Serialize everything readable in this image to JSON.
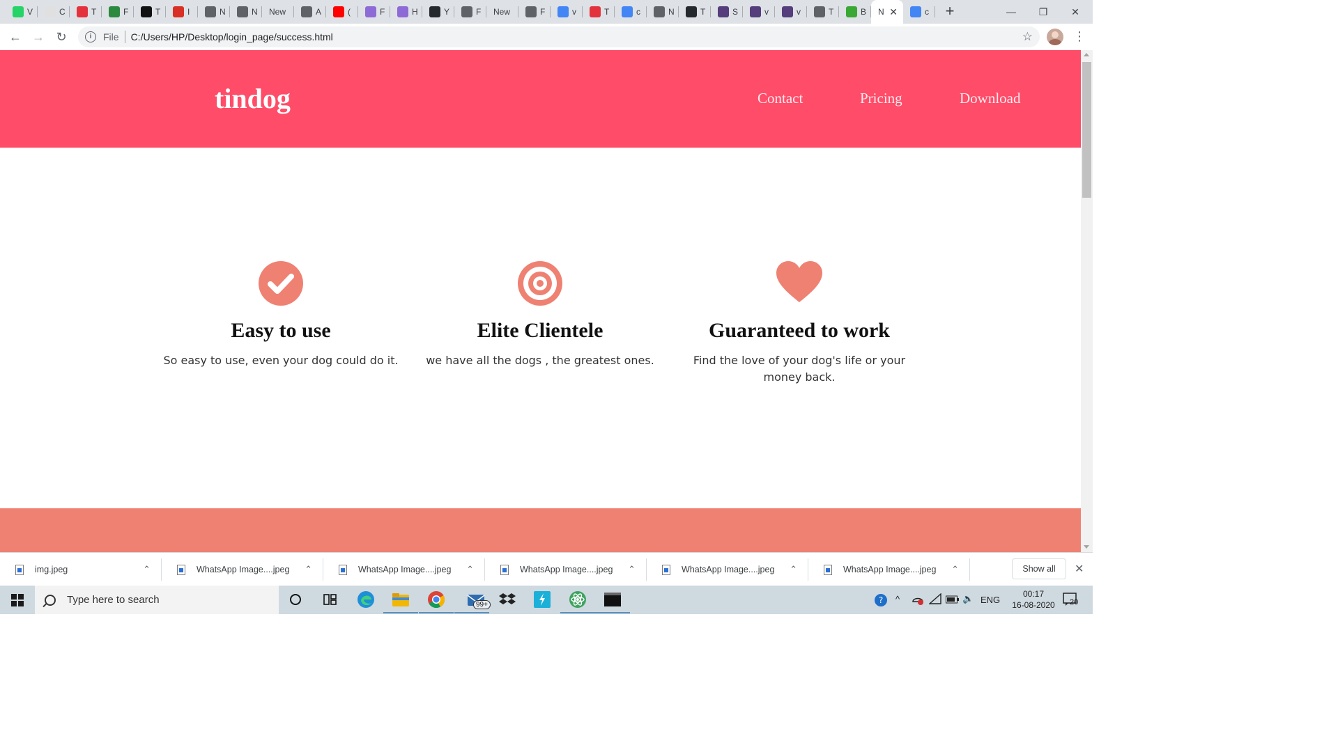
{
  "browser": {
    "tabs": [
      {
        "title": "V",
        "color": "#25d366"
      },
      {
        "title": "C",
        "color": "#e0e0e0"
      },
      {
        "title": "T",
        "color": "#e4323c"
      },
      {
        "title": "F",
        "color": "#2b8a3e"
      },
      {
        "title": "T",
        "color": "#111111"
      },
      {
        "title": "I",
        "color": "#d93025"
      },
      {
        "title": "N",
        "color": "#5f6368"
      },
      {
        "title": "N",
        "color": "#5f6368"
      },
      {
        "title": "New",
        "color": null
      },
      {
        "title": "A",
        "color": "#5f6368"
      },
      {
        "title": "(",
        "color": "#ff0000"
      },
      {
        "title": "F",
        "color": "#8e6ad6"
      },
      {
        "title": "H",
        "color": "#8e6ad6"
      },
      {
        "title": "Y",
        "color": "#24292e"
      },
      {
        "title": "F",
        "color": "#5f6368"
      },
      {
        "title": "New",
        "color": null
      },
      {
        "title": "F",
        "color": "#5f6368"
      },
      {
        "title": "v",
        "color": "#4285f4"
      },
      {
        "title": "T",
        "color": "#e4323c"
      },
      {
        "title": "c",
        "color": "#4285f4"
      },
      {
        "title": "N",
        "color": "#5f6368"
      },
      {
        "title": "T",
        "color": "#24292e"
      },
      {
        "title": "S",
        "color": "#563d7c"
      },
      {
        "title": "v",
        "color": "#563d7c"
      },
      {
        "title": "v",
        "color": "#563d7c"
      },
      {
        "title": "T",
        "color": "#5f6368"
      },
      {
        "title": "B",
        "color": "#3aa835"
      },
      {
        "title": "N",
        "color": null,
        "active": true
      },
      {
        "title": "c",
        "color": "#4285f4"
      }
    ],
    "new_tab_label": "+",
    "address": {
      "scheme": "File",
      "url": "C:/Users/HP/Desktop/login_page/success.html"
    }
  },
  "site": {
    "brand": "tindog",
    "nav": [
      "Contact",
      "Pricing",
      "Download"
    ],
    "features": [
      {
        "icon": "check-circle-icon",
        "title": "Easy to use",
        "text": "So easy to use, even your dog could do it."
      },
      {
        "icon": "bullseye-icon",
        "title": "Elite Clientele",
        "text": "we have all the dogs , the greatest ones."
      },
      {
        "icon": "heart-icon",
        "title": "Guaranteed to work",
        "text": "Find the love of your dog's life or your money back."
      }
    ],
    "colors": {
      "header": "#ff4c68",
      "icon": "#ef8172",
      "band": "#ef8172"
    }
  },
  "downloads": {
    "items": [
      "img.jpeg",
      "WhatsApp Image....jpeg",
      "WhatsApp Image....jpeg",
      "WhatsApp Image....jpeg",
      "WhatsApp Image....jpeg",
      "WhatsApp Image....jpeg"
    ],
    "show_all": "Show all"
  },
  "taskbar": {
    "search_placeholder": "Type here to search",
    "mail_badge": "99+",
    "language": "ENG",
    "time": "00:17",
    "date": "16-08-2020",
    "notifications": "20"
  }
}
